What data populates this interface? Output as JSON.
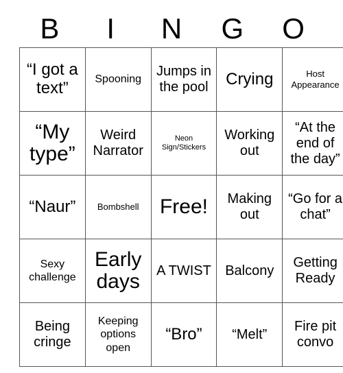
{
  "header": {
    "letters": [
      "B",
      "I",
      "N",
      "G",
      "O"
    ]
  },
  "grid": {
    "rows": [
      [
        {
          "text": "“I got a text”",
          "size": "fs-lg"
        },
        {
          "text": "Spooning",
          "size": "fs-sm"
        },
        {
          "text": "Jumps in the pool",
          "size": "fs-md"
        },
        {
          "text": "Crying",
          "size": "fs-lg"
        },
        {
          "text": "Host Appearance",
          "size": "fs-xs"
        }
      ],
      [
        {
          "text": "“My type”",
          "size": "fs-xl"
        },
        {
          "text": "Weird Narrator",
          "size": "fs-md"
        },
        {
          "text": "Neon Sign/Stickers",
          "size": "fs-xxs"
        },
        {
          "text": "Working out",
          "size": "fs-md"
        },
        {
          "text": "“At the end of the day”",
          "size": "fs-md"
        }
      ],
      [
        {
          "text": "“Naur”",
          "size": "fs-lg"
        },
        {
          "text": "Bombshell",
          "size": "fs-xs"
        },
        {
          "text": "Free!",
          "size": "fs-xl"
        },
        {
          "text": "Making out",
          "size": "fs-md"
        },
        {
          "text": "“Go for a chat”",
          "size": "fs-md"
        }
      ],
      [
        {
          "text": "Sexy challenge",
          "size": "fs-sm"
        },
        {
          "text": "Early days",
          "size": "fs-xl"
        },
        {
          "text": "A TWIST",
          "size": "fs-md"
        },
        {
          "text": "Balcony",
          "size": "fs-md"
        },
        {
          "text": "Getting Ready",
          "size": "fs-md"
        }
      ],
      [
        {
          "text": "Being cringe",
          "size": "fs-md"
        },
        {
          "text": "Keeping options open",
          "size": "fs-sm"
        },
        {
          "text": "“Bro”",
          "size": "fs-lg"
        },
        {
          "text": "“Melt”",
          "size": "fs-md"
        },
        {
          "text": "Fire pit convo",
          "size": "fs-md"
        }
      ]
    ]
  },
  "colors": {
    "border": "#555555",
    "text": "#000000",
    "background": "#ffffff"
  }
}
